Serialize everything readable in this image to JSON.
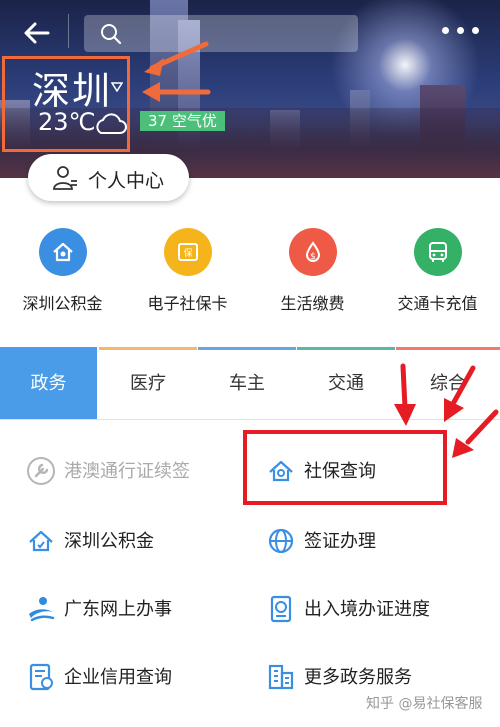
{
  "header": {
    "city": "深圳",
    "temperature": "23℃",
    "aqi": "37 空气优",
    "personal_center": "个人中心"
  },
  "quick_services": [
    {
      "label": "深圳公积金",
      "icon": "housing-fund-icon",
      "color": "#3b8fe3"
    },
    {
      "label": "电子社保卡",
      "icon": "social-card-icon",
      "color": "#f5b41b"
    },
    {
      "label": "生活缴费",
      "icon": "bill-payment-icon",
      "color": "#ee5a45"
    },
    {
      "label": "交通卡充值",
      "icon": "bus-icon",
      "color": "#34b067"
    }
  ],
  "tabs": [
    {
      "label": "政务",
      "active": true,
      "color": "#4a9ce8"
    },
    {
      "label": "医疗",
      "active": false,
      "color": "#f4b86a"
    },
    {
      "label": "车主",
      "active": false,
      "color": "#63a7e6"
    },
    {
      "label": "交通",
      "active": false,
      "color": "#56b9a6"
    },
    {
      "label": "综合",
      "active": false,
      "color": "#f07a6f"
    }
  ],
  "services": [
    {
      "label": "港澳通行证续签",
      "icon": "wrench-icon",
      "enabled": false
    },
    {
      "label": "社保查询",
      "icon": "social-security-icon",
      "enabled": true
    },
    {
      "label": "深圳公积金",
      "icon": "housing-fund-icon",
      "enabled": true
    },
    {
      "label": "签证办理",
      "icon": "globe-icon",
      "enabled": true
    },
    {
      "label": "广东网上办事",
      "icon": "guangdong-icon",
      "enabled": true
    },
    {
      "label": "出入境办证进度",
      "icon": "passport-icon",
      "enabled": true
    },
    {
      "label": "企业信用查询",
      "icon": "credit-icon",
      "enabled": true
    },
    {
      "label": "更多政务服务",
      "icon": "building-icon",
      "enabled": true
    }
  ],
  "watermark": "知乎 @易社保客服",
  "annotation_colors": {
    "orange": "#f06a3a",
    "red": "#e51c23"
  }
}
